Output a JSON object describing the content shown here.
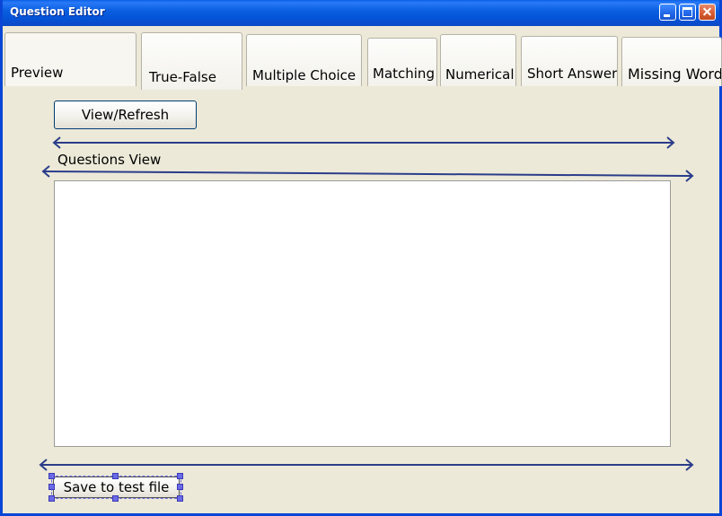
{
  "window": {
    "title": "Question Editor",
    "accent_color": "#0a5fe6"
  },
  "tabs": [
    {
      "label": "Preview",
      "selected": true
    },
    {
      "label": "True-False",
      "selected": false
    },
    {
      "label": "Multiple Choice",
      "selected": false
    },
    {
      "label": "Matching",
      "selected": false
    },
    {
      "label": "Numerical",
      "selected": false
    },
    {
      "label": "Short Answer",
      "selected": false
    },
    {
      "label": "Missing Word",
      "selected": false
    }
  ],
  "preview": {
    "refresh_button_label": "View/Refresh",
    "questions_view_label": "Questions View",
    "questions_view_value": "",
    "save_button_label": "Save to test file",
    "arrow_color": "#2b3d8a",
    "selection_color": "#6b6be8"
  },
  "icons": {
    "minimize": "minimize-icon",
    "maximize": "maximize-icon",
    "close": "close-icon",
    "arrow": "double-arrow-icon"
  }
}
